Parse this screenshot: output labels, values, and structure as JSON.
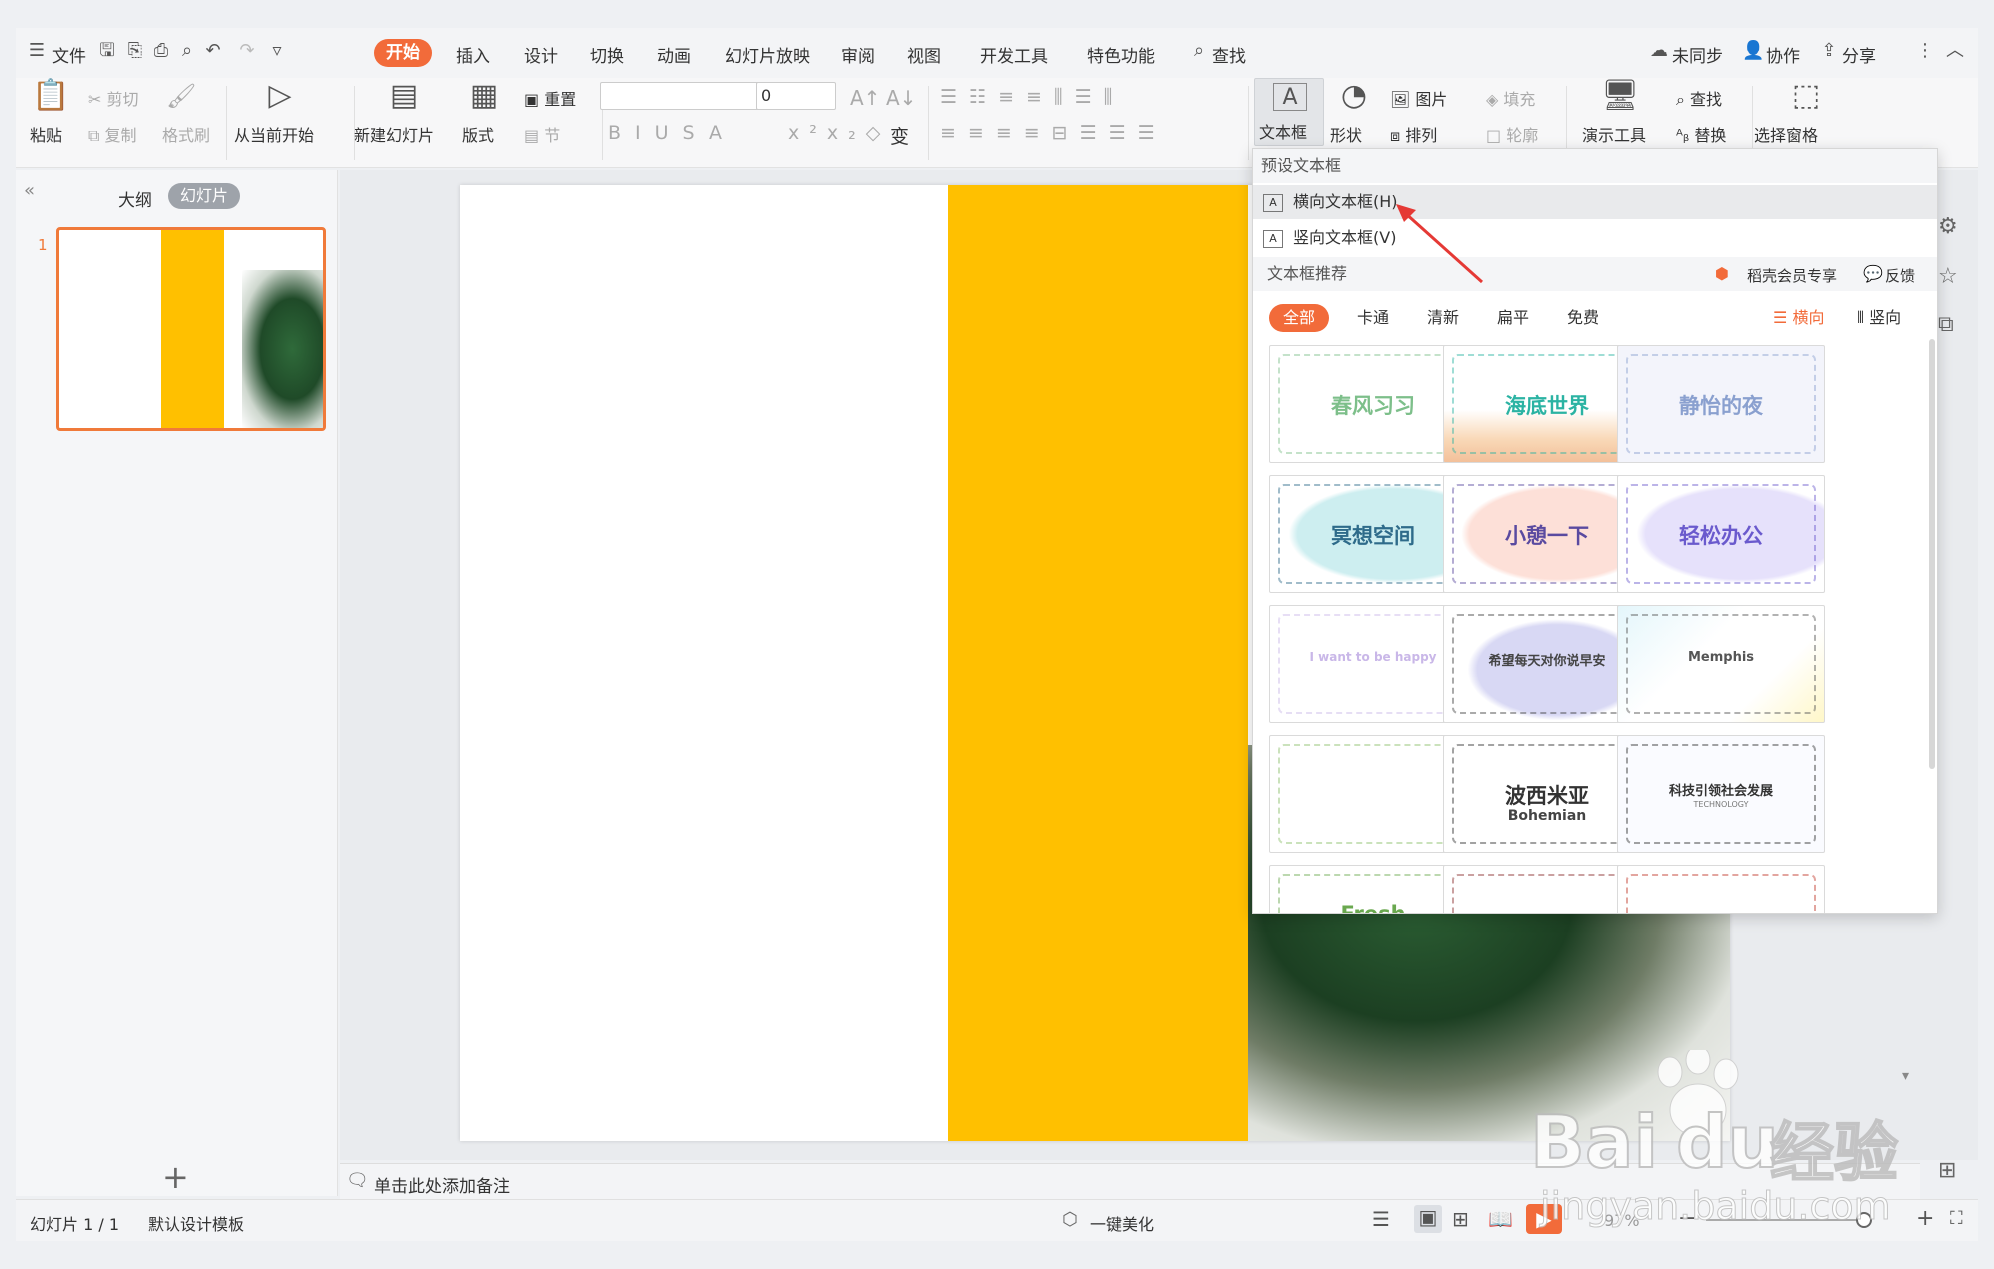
{
  "menubar": {
    "file_label": "文件",
    "tabs": [
      "开始",
      "插入",
      "设计",
      "切换",
      "动画",
      "幻灯片放映",
      "审阅",
      "视图",
      "开发工具",
      "特色功能"
    ],
    "active_tab": "开始",
    "search_label": "查找",
    "right": {
      "sync": "未同步",
      "collab": "协作",
      "share": "分享"
    }
  },
  "ribbon": {
    "paste": "粘贴",
    "cut": "剪切",
    "copy": "复制",
    "format_painter": "格式刷",
    "from_current": "从当前开始",
    "new_slide": "新建幻灯片",
    "layout": "版式",
    "reset": "重置",
    "section": "节",
    "font_size": "0",
    "textbox": "文本框",
    "shape": "形状",
    "arrange": "排列",
    "picture": "图片",
    "fill": "填充",
    "outline": "轮廓",
    "present_tools": "演示工具",
    "find": "查找",
    "replace": "替换",
    "selection_pane": "选择窗格"
  },
  "leftpane": {
    "tab_outline": "大纲",
    "tab_slides": "幻灯片",
    "slide_number": "1",
    "add_label": "+"
  },
  "dropdown": {
    "preset_header": "预设文本框",
    "horizontal": "横向文本框(H)",
    "vertical": "竖向文本框(V)",
    "recommend_header": "文本框推荐",
    "member": "稻壳会员专享",
    "feedback": "反馈",
    "filters": [
      "全部",
      "卡通",
      "清新",
      "扁平",
      "免费"
    ],
    "orient_h": "横向",
    "orient_v": "竖向",
    "cards": [
      {
        "label": "春风习习",
        "color": "#7dbf8a"
      },
      {
        "label": "海底世界",
        "color": "#2bb3a3"
      },
      {
        "label": "静怡的夜",
        "color": "#8aa0cf"
      },
      {
        "label": "冥想空间",
        "color": "#2e6b8a"
      },
      {
        "label": "小憩一下",
        "color": "#5a4aa0"
      },
      {
        "label": "轻松办公",
        "color": "#6a5acd"
      },
      {
        "label": "I want to be happy",
        "color": "#c9b7e8"
      },
      {
        "label": "希望每天对你说早安",
        "color": "#444"
      },
      {
        "label": "Memphis",
        "color": "#555"
      },
      {
        "label": "",
        "color": "#8cbf6a"
      },
      {
        "label": "波西米亚",
        "color": "#333"
      },
      {
        "label": "科技引领社会发展",
        "color": "#333"
      },
      {
        "label": "Fresh",
        "color": "#6aa84f"
      },
      {
        "label": "",
        "color": "#8b2e2e"
      },
      {
        "label": "",
        "color": "#c0392b"
      }
    ],
    "card_sub_bohemian": "Bohemian",
    "card_sub_tech": "TECHNOLOGY"
  },
  "notes": {
    "placeholder": "单击此处添加备注"
  },
  "statusbar": {
    "slide_count": "幻灯片 1 / 1",
    "template": "默认设计模板",
    "beautify": "一键美化",
    "zoom": "97%"
  },
  "watermark": {
    "line1": "Bai",
    "line2": "du",
    "cn": "经验",
    "url": "jingyan.baidu.com"
  },
  "colors": {
    "accent": "#f26b3a",
    "slide_yellow": "#ffc000",
    "thumb_border": "#f07a3a"
  }
}
